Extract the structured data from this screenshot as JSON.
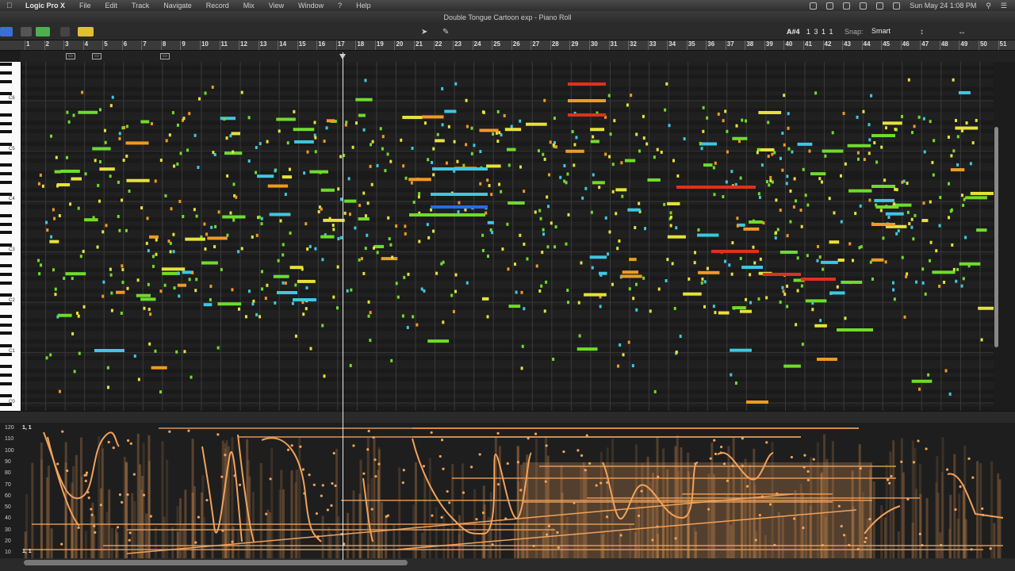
{
  "menubar": {
    "app": "Logic Pro X",
    "items": [
      "File",
      "Edit",
      "Track",
      "Navigate",
      "Record",
      "Mix",
      "View",
      "Window",
      "?",
      "Help"
    ],
    "clock": "Sun May 24  1:08 PM"
  },
  "window": {
    "title": "Double Tongue Cartoon exp - Piano Roll"
  },
  "toolbar": {
    "position_note": "A#4",
    "position_time": "1 3 1 1",
    "snap_label": "Snap:",
    "snap_value": "Smart"
  },
  "ruler": {
    "bars": [
      "1",
      "2",
      "3",
      "4",
      "5",
      "6",
      "7",
      "8",
      "9",
      "10",
      "11",
      "12",
      "13",
      "14",
      "15",
      "16",
      "17",
      "18",
      "19",
      "20",
      "21",
      "22",
      "23",
      "24",
      "25",
      "26",
      "27",
      "28",
      "29",
      "30",
      "31",
      "32",
      "33",
      "34",
      "35",
      "36",
      "37",
      "38",
      "39",
      "40",
      "41",
      "42",
      "43",
      "44",
      "45",
      "46",
      "47",
      "48",
      "49",
      "50",
      "51"
    ]
  },
  "keyboard": {
    "octave_labels": [
      "C6",
      "C5",
      "C4",
      "C3",
      "C2",
      "C1",
      "C0"
    ]
  },
  "automation": {
    "lane_label": "1, 1",
    "y_ticks": [
      "120",
      "110",
      "100",
      "90",
      "80",
      "70",
      "60",
      "50",
      "40",
      "30",
      "20",
      "10"
    ],
    "bottom_label": "1, 1"
  },
  "colors": {
    "note_green": "#6fdc2a",
    "note_yellow": "#e6e23a",
    "note_cyan": "#3ec8e0",
    "note_blue": "#2a6ae0",
    "note_orange": "#f09a22",
    "note_red": "#e0301c",
    "automation": "#f2a25a"
  }
}
